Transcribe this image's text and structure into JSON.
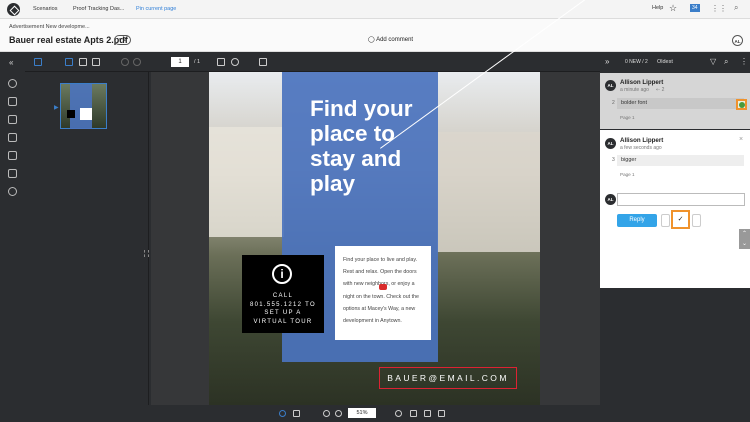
{
  "topbar": {
    "tabs": [
      "Scenarios",
      "Proof Tracking Das...",
      "Pin current page"
    ],
    "help": "Help",
    "badge": "34"
  },
  "header": {
    "breadcrumb": "Advertisement New developme...",
    "file_title": "Bauer real estate Apts 2.pdf",
    "version": "v 1",
    "add_comment": "Add comment",
    "avatar": "AL"
  },
  "toolbar": {
    "page": "1",
    "total": "/ 1"
  },
  "document": {
    "headline": "Find your place to stay and play",
    "body": "Find your place to live and play. Rest and relax. Open the doors with new neighbors, or enjoy a night on the town. Check out the options at Macey's Way, a new development in Anytown.",
    "call": "CALL 801.555.1212 TO SET UP A VIRTUAL TOUR",
    "info_icon": "i",
    "email": "BAUER@EMAIL.COM"
  },
  "bottombar": {
    "zoom": "51%"
  },
  "comments": {
    "new_count": "0 NEW / 2",
    "sort": "Oldest",
    "items": [
      {
        "avatar": "AL",
        "name": "Allison Lippert",
        "time": "a minute ago",
        "replies": "2",
        "num": "2",
        "text": "bolder font",
        "page": "Page 1"
      },
      {
        "avatar": "AL",
        "name": "Allison Lippert",
        "time": "a few seconds ago",
        "num": "3",
        "text": "bigger",
        "page": "Page 1"
      }
    ],
    "reply_avatar": "AL",
    "reply_button": "Reply",
    "check_mark": "✓"
  }
}
